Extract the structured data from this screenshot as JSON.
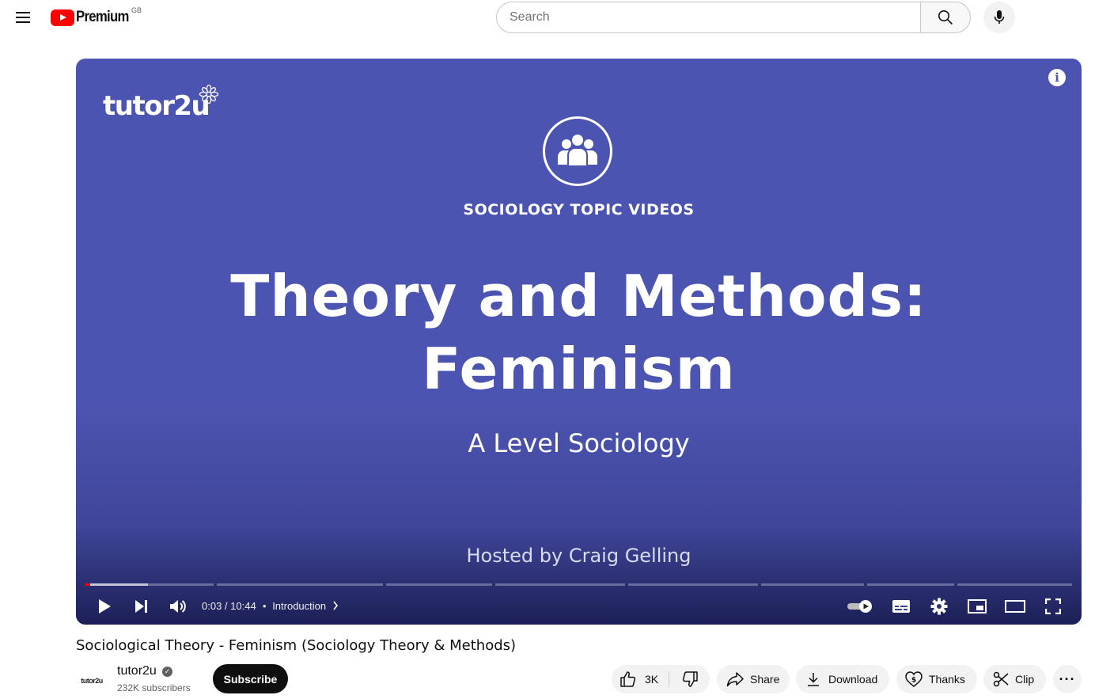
{
  "header": {
    "logo_text": "Premium",
    "region": "GB",
    "search_placeholder": "Search"
  },
  "player": {
    "brand": "tutor2u",
    "topic_label": "SOCIOLOGY TOPIC VIDEOS",
    "title_line1": "Theory and Methods:",
    "title_line2": "Feminism",
    "subtitle": "A Level Sociology",
    "hosted_by": "Hosted by Craig Gelling",
    "info_glyph": "i",
    "time": "0:03 / 10:44",
    "chapter": "Introduction",
    "chapter_separator": "•",
    "progress_fraction": 0.005,
    "autoplay": true
  },
  "video": {
    "title": "Sociological Theory - Feminism (Sociology Theory & Methods)"
  },
  "channel": {
    "avatar_text": "tutor2u",
    "name": "tutor2u",
    "subscribers": "232K subscribers",
    "subscribe_label": "Subscribe"
  },
  "actions": {
    "like_count": "3K",
    "share_label": "Share",
    "download_label": "Download",
    "thanks_label": "Thanks",
    "clip_label": "Clip",
    "more_label": "···"
  },
  "colors": {
    "brand_red": "#ff0000",
    "player_bg": "#4c54b1",
    "subscribe_bg": "#0f0f0f"
  }
}
